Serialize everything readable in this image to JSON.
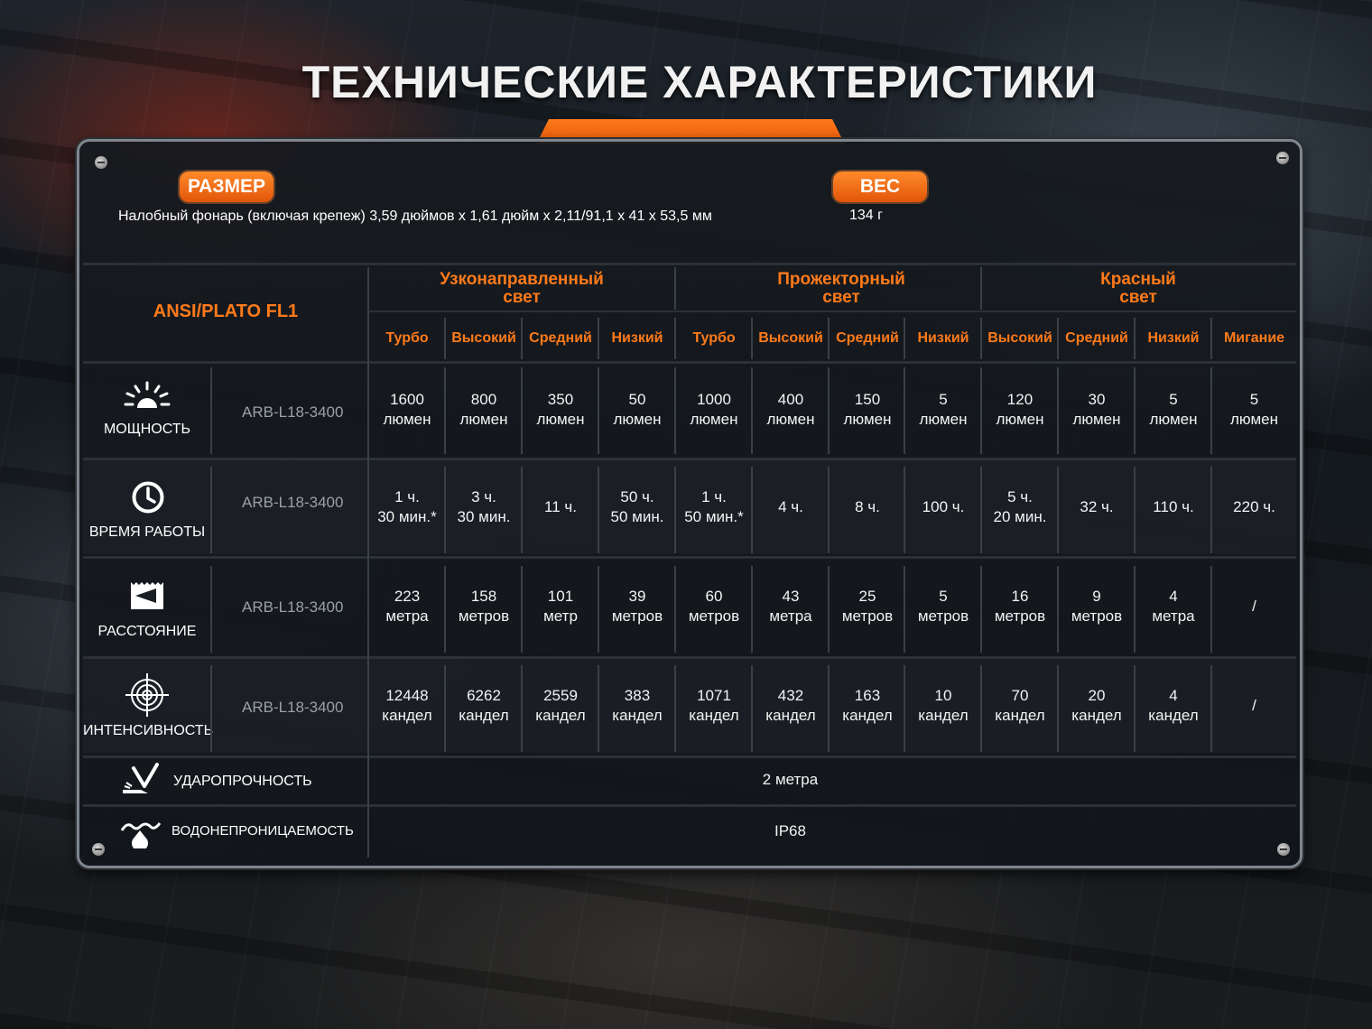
{
  "title": "ТЕХНИЧЕСКИЕ ХАРАКТЕРИСТИКИ",
  "size": {
    "label": "РАЗМЕР",
    "value": "Налобный фонарь (включая крепеж) 3,59 дюймов x 1,61 дюйм x 2,11/91,1 x 41 x 53,5 мм"
  },
  "weight": {
    "label": "ВЕС",
    "value": "134 г"
  },
  "standard": "ANSI/PLATO FL1",
  "groups": [
    {
      "name": "Узконаправленный\nсвет"
    },
    {
      "name": "Прожекторный\nсвет"
    },
    {
      "name": "Красный\nсвет"
    }
  ],
  "modes": [
    "Турбо",
    "Высокий",
    "Средний",
    "Низкий",
    "Турбо",
    "Высокий",
    "Средний",
    "Низкий",
    "Высокий",
    "Средний",
    "Низкий",
    "Мигание"
  ],
  "rows": [
    {
      "label": "МОЩНОСТЬ",
      "icon": "sunburst-icon",
      "model": "ARB-L18-3400",
      "values": [
        "1600\nлюмен",
        "800\nлюмен",
        "350\nлюмен",
        "50\nлюмен",
        "1000\nлюмен",
        "400\nлюмен",
        "150\nлюмен",
        "5\nлюмен",
        "120\nлюмен",
        "30\nлюмен",
        "5\nлюмен",
        "5\nлюмен"
      ]
    },
    {
      "label": "ВРЕМЯ РАБОТЫ",
      "icon": "clock-icon",
      "model": "ARB-L18-3400",
      "values": [
        "1 ч.\n30 мин.*",
        "3 ч.\n30 мин.",
        "11 ч.",
        "50 ч.\n50 мин.",
        "1 ч.\n50 мин.*",
        "4 ч.",
        "8 ч.",
        "100 ч.",
        "5 ч.\n20 мин.",
        "32 ч.",
        "110 ч.",
        "220 ч."
      ]
    },
    {
      "label": "РАССТОЯНИЕ",
      "icon": "beam-distance-icon",
      "model": "ARB-L18-3400",
      "values": [
        "223\nметра",
        "158\nметров",
        "101\nметр",
        "39\nметров",
        "60\nметров",
        "43\nметра",
        "25\nметров",
        "5\nметров",
        "16\nметров",
        "9\nметров",
        "4\nметра",
        "/"
      ]
    },
    {
      "label": "ИНТЕНСИВНОСТЬ",
      "icon": "target-icon",
      "model": "ARB-L18-3400",
      "values": [
        "12448\nкандел",
        "6262\nкандел",
        "2559\nкандел",
        "383\nкандел",
        "1071\nкандел",
        "432\nкандел",
        "163\nкандел",
        "10\nкандел",
        "70\nкандел",
        "20\nкандел",
        "4\nкандел",
        "/"
      ]
    }
  ],
  "impact": {
    "label": "УДАРОПРОЧНОСТЬ",
    "icon": "impact-icon",
    "value": "2 метра"
  },
  "water": {
    "label": "ВОДОНЕПРОНИЦАЕМОСТЬ",
    "icon": "water-drop-icon",
    "value": "IP68"
  }
}
